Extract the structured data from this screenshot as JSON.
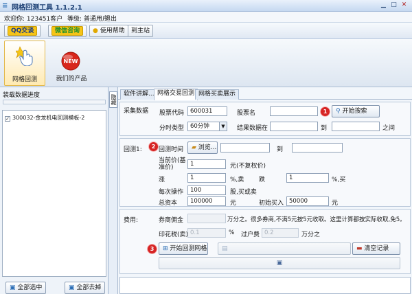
{
  "window": {
    "title": "网格回测工具 1.1.2.1",
    "icon": "app-grid-icon",
    "controls": [
      "minimize-icon",
      "maximize-icon",
      "close-icon"
    ]
  },
  "user_bar": {
    "welcome": "欢迎你: 123451客户",
    "level": "等级: 普通用户",
    "logout": "退出"
  },
  "toolbar": {
    "qq_label": "QQ交谈",
    "wechat_label": "微信咨询",
    "help_label": "使用帮助",
    "home_label": "到主站"
  },
  "ribbon": {
    "grid_backtest": "网格回测",
    "our_products": "我们的产品",
    "new_badge": "NEW"
  },
  "left_panel": {
    "title": "装载数据进度",
    "progress": 0,
    "items": [
      {
        "label": "300032-金龙机电回测模板-2",
        "checked": true
      }
    ],
    "select_all": "全部选中",
    "deselect_all": "全部去掉"
  },
  "side_tab": {
    "label": "隐藏"
  },
  "tabs": [
    "软件讲解...",
    "网格交易回测",
    "网格买卖展示"
  ],
  "active_tab": 1,
  "collect": {
    "section_label": "采集数据",
    "stock_code_label": "股票代码",
    "stock_code": "600031",
    "stock_name_label": "股票名",
    "stock_name": "",
    "search_button": "开始搜索",
    "period_label": "分时类型",
    "period_value": "60分钟",
    "result_label": "结果数据在",
    "result_from": "",
    "to_label": "到",
    "result_to": "",
    "between_label": "之间"
  },
  "backtest": {
    "section_label": "回测1:",
    "time_button": "回测时间",
    "browse_button": "浏览...",
    "time_from": "",
    "to_label": "到",
    "time_to": "",
    "price_label": "当前价(基准价)",
    "price": "1",
    "price_unit": "元(不复权价)",
    "rise_label": "涨",
    "rise": "1",
    "rise_unit": "%,卖",
    "fall_label": "跌",
    "fall": "1",
    "fall_unit": "%,买",
    "per_trade_label": "每次操作",
    "per_trade": "100",
    "per_trade_unit": "股,买或卖",
    "capital_label": "总资本",
    "capital": "100000",
    "capital_unit": "元",
    "init_buy_label": "初始买入",
    "init_buy": "50000",
    "init_buy_unit": "元"
  },
  "fees": {
    "section_label": "费用:",
    "commission_label": "券商佣金",
    "commission": "",
    "commission_note": "万分之。很多券商,不满5元按5元收取。这里计算都按实际收取,免5。",
    "stamp_label": "印花税(卖)",
    "stamp": "0.1",
    "stamp_unit": "%",
    "transfer_label": "过户费",
    "transfer": "0.2",
    "transfer_unit": "万分之",
    "start_button": "开始回测网格",
    "clear_button": "清空记录"
  },
  "badges": [
    "1",
    "2",
    "3"
  ]
}
